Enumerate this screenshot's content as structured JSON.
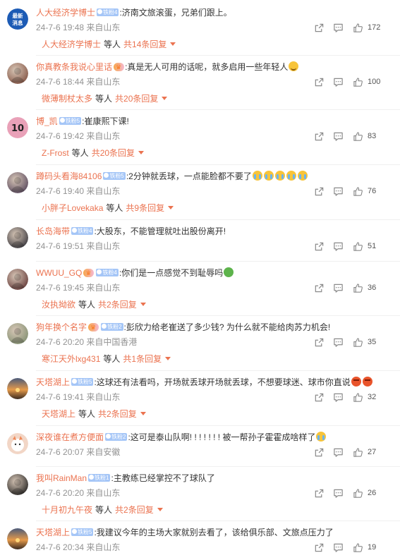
{
  "comments": [
    {
      "name": "人大经济学博士",
      "badge": "铁粉4",
      "vip": "",
      "text": ":济南文旅滚蛋，兄弟们跟上。",
      "emoji": [],
      "time": "24-7-6 19:48",
      "location": "来自山东",
      "likes": "172",
      "reply": {
        "name": "人大经济学博士",
        "mid": "等人",
        "count": "共14条回复"
      },
      "avatar_color": "#1c5bb5",
      "avatar_kind": "news",
      "avatar_text": "最新\n消息"
    },
    {
      "name": "你真教条我说心里话",
      "badge": "",
      "vip": "铁粉9",
      "text": ":真是无人可用的话呢，就多启用一些年轻人",
      "emoji": [
        "smile"
      ],
      "time": "24-7-6 18:44",
      "location": "来自山东",
      "likes": "100",
      "reply": {
        "name": "微薄制杖太多",
        "mid": "等人",
        "count": "共20条回复"
      },
      "avatar_color": "#7c4a3a",
      "avatar_kind": "photo"
    },
    {
      "name": "博_凯",
      "badge": "铁粉5",
      "vip": "",
      "text": ":崔康熙下课!",
      "emoji": [],
      "time": "24-7-6 19:42",
      "location": "来自山东",
      "likes": "83",
      "reply": {
        "name": "Z-Frost",
        "mid": "等人",
        "count": "共20条回复"
      },
      "avatar_color": "#e9a1b8",
      "avatar_kind": "ten",
      "avatar_text": "10"
    },
    {
      "name": "蹲码头看海84106",
      "badge": "铁粉5",
      "vip": "",
      "text": ":2分钟就丢球，一点能脸都不要了",
      "emoji": [
        "cry",
        "cry",
        "cry",
        "cry",
        "cry"
      ],
      "time": "24-7-6 19:40",
      "location": "来自山东",
      "likes": "76",
      "reply": {
        "name": "小胖子Lovekaka",
        "mid": "等人",
        "count": "共9条回复"
      },
      "avatar_color": "#4d3d55",
      "avatar_kind": "photo"
    },
    {
      "name": "长岛海带",
      "badge": "铁粉4",
      "vip": "",
      "text": ":大股东，不能管理就吐出股份离开!",
      "emoji": [],
      "time": "24-7-6 19:51",
      "location": "来自山东",
      "likes": "51",
      "reply": null,
      "avatar_color": "#2b2b33",
      "avatar_kind": "photo"
    },
    {
      "name": "WWUU_GQ",
      "badge": "铁粉4",
      "vip": "crown",
      "text": ":你们是一点感觉不到耻辱吗",
      "emoji": [
        "green"
      ],
      "time": "24-7-6 19:45",
      "location": "来自山东",
      "likes": "36",
      "reply": {
        "name": "汝执拗欲",
        "mid": "等人",
        "count": "共2条回复"
      },
      "avatar_color": "#5a2d2d",
      "avatar_kind": "photo"
    },
    {
      "name": "狗年换个名字",
      "badge": "铁粉2",
      "vip": "crown",
      "text": ":彭欣力给老崔送了多少钱? 为什么就不能给肉苏力机会!",
      "emoji": [],
      "time": "24-7-6 20:20",
      "location": "来自中国香港",
      "likes": "35",
      "reply": {
        "name": "寒江天外lxg431",
        "mid": "等人",
        "count": "共1条回复"
      },
      "avatar_color": "#7a8a6a",
      "avatar_kind": "photo"
    },
    {
      "name": "天塔湖上",
      "badge": "铁粉5",
      "vip": "",
      "text": ":这球还有法看吗，开场就丢球开场就丢球，不想要球迷、球市你直说",
      "emoji": [
        "angry",
        "angry"
      ],
      "time": "24-7-6 19:41",
      "location": "来自山东",
      "likes": "32",
      "reply": {
        "name": "天塔湖上",
        "mid": "等人",
        "count": "共2条回复"
      },
      "avatar_color": "#c7773a",
      "avatar_kind": "sunset"
    },
    {
      "name": "深夜谁在煮方便面",
      "badge": "铁粉2",
      "vip": "",
      "text": ":这可是泰山队啊! ! ! ! ! ! ! 被一帮孙子霍霍成啥样了",
      "emoji": [
        "cry"
      ],
      "time": "24-7-6 20:07",
      "location": "来自安徽",
      "likes": "27",
      "reply": null,
      "avatar_color": "#f2d6c6",
      "avatar_kind": "cartoon"
    },
    {
      "name": "我叫RainMan",
      "badge": "铁粉1",
      "vip": "",
      "text": ":主教练已经掌控不了球队了",
      "emoji": [],
      "time": "24-7-6 20:20",
      "location": "来自山东",
      "likes": "26",
      "reply": {
        "name": "十月初九午夜",
        "mid": "等人",
        "count": "共2条回复"
      },
      "avatar_color": "#151515",
      "avatar_kind": "photo"
    },
    {
      "name": "天塔湖上",
      "badge": "铁粉5",
      "vip": "",
      "text": ":我建议今年的主场大家就别去看了，该给俱乐部、文旅点压力了",
      "emoji": [],
      "time": "24-7-6 20:34",
      "location": "来自山东",
      "likes": "19",
      "reply": null,
      "avatar_color": "#c7773a",
      "avatar_kind": "sunset"
    }
  ]
}
